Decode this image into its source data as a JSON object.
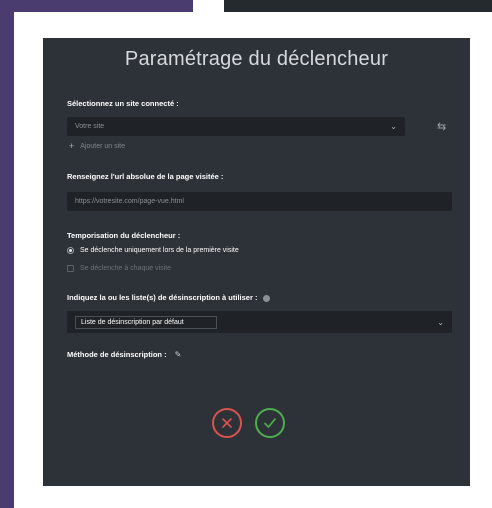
{
  "dialog": {
    "title": "Paramétrage du déclencheur",
    "site_label": "Sélectionnez un site connecté :",
    "site_value": "Votre site",
    "add_site": "Ajouter un site",
    "url_label": "Renseignez l'url absolue de la page visitée :",
    "url_placeholder": "https://votresite.com/page-vue.html",
    "timing_label": "Temporisation du déclencheur :",
    "timing_options": [
      {
        "label": "Se déclenche uniquement lors de la première visite",
        "selected": true
      },
      {
        "label": "Se déclenche à chaque visite",
        "selected": false
      }
    ],
    "list_label": "Indiquez la ou les liste(s) de désinscription à utiliser :",
    "list_value": "Liste de désinscription par défaut",
    "method_label": "Méthode de désinscription :"
  },
  "colors": {
    "cancel": "#d9534f",
    "confirm": "#4cae4c"
  }
}
